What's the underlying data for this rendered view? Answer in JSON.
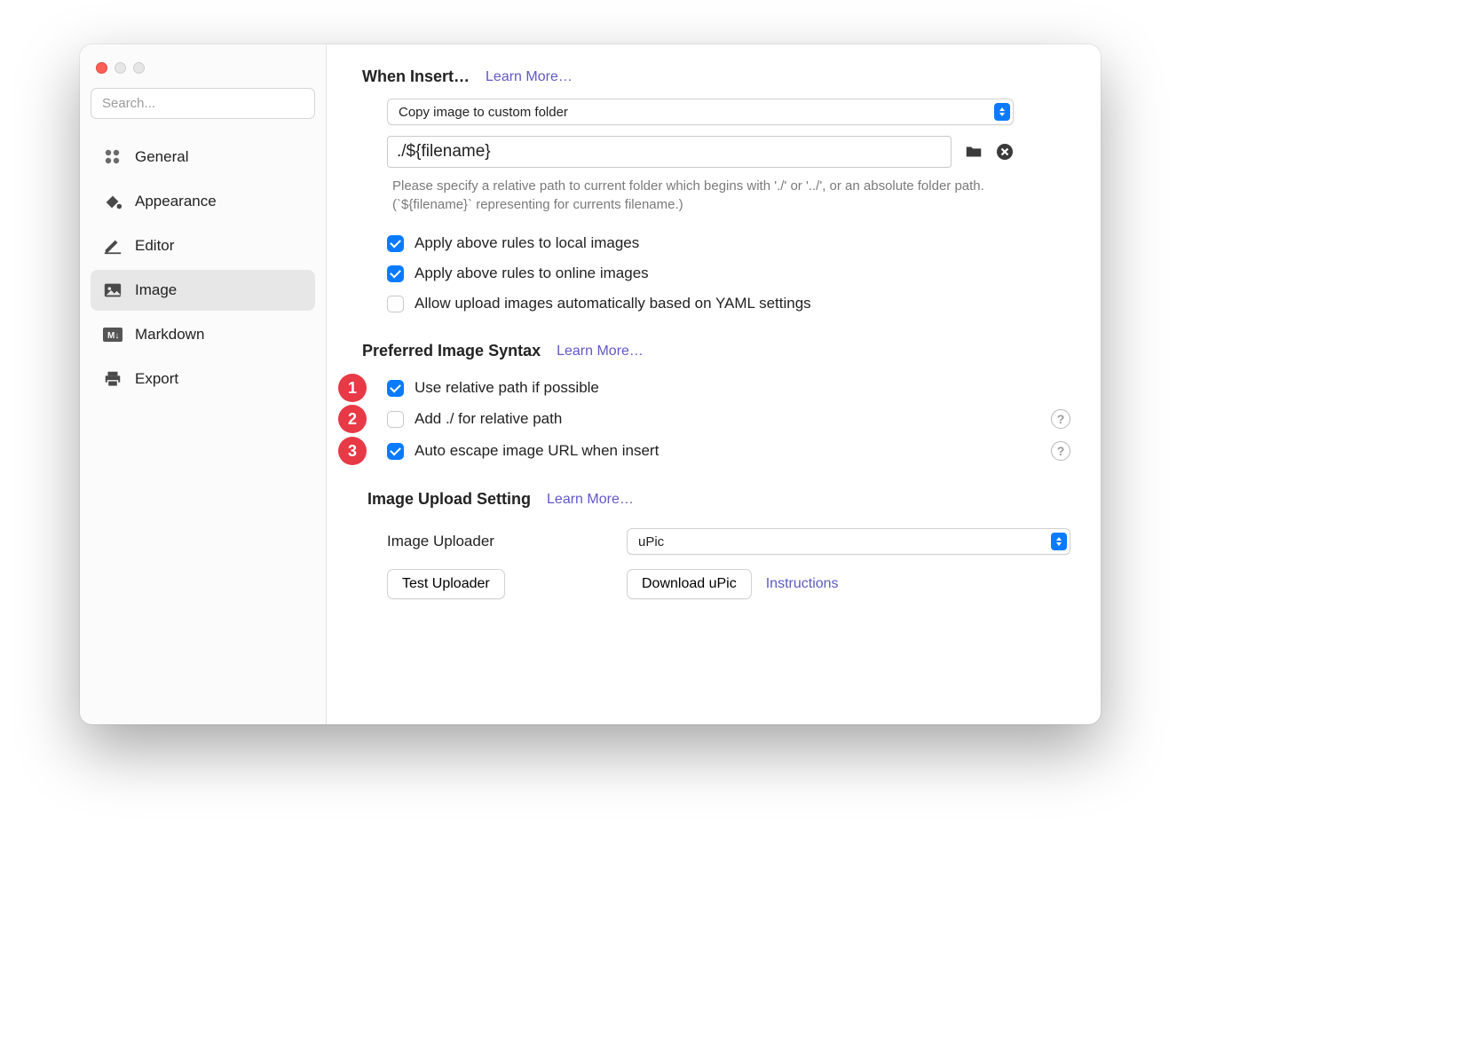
{
  "sidebar": {
    "search_placeholder": "Search...",
    "items": [
      {
        "label": "General"
      },
      {
        "label": "Appearance"
      },
      {
        "label": "Editor"
      },
      {
        "label": "Image"
      },
      {
        "label": "Markdown"
      },
      {
        "label": "Export"
      }
    ]
  },
  "sections": {
    "insert": {
      "title": "When Insert…",
      "learn_more": "Learn More…",
      "action_select": "Copy image to custom folder",
      "path_value": "./${filename}",
      "hint": "Please specify a relative path to current folder which begins with './' or '../', or an absolute folder path. (`${filename}` representing for currents filename.)",
      "opt_local": "Apply above rules to local images",
      "opt_online": "Apply above rules to online images",
      "opt_yaml": "Allow upload images automatically based on YAML settings"
    },
    "syntax": {
      "title": "Preferred Image Syntax",
      "learn_more": "Learn More…",
      "opt_relative": "Use relative path if possible",
      "opt_dotslash": "Add ./ for relative path",
      "opt_escape": "Auto escape image URL when insert"
    },
    "upload": {
      "title": "Image Upload Setting",
      "learn_more": "Learn More…",
      "uploader_label": "Image Uploader",
      "uploader_value": "uPic",
      "test_button": "Test Uploader",
      "download_button": "Download uPic",
      "instructions": "Instructions"
    }
  },
  "annotations": {
    "b1": "1",
    "b2": "2",
    "b3": "3"
  }
}
